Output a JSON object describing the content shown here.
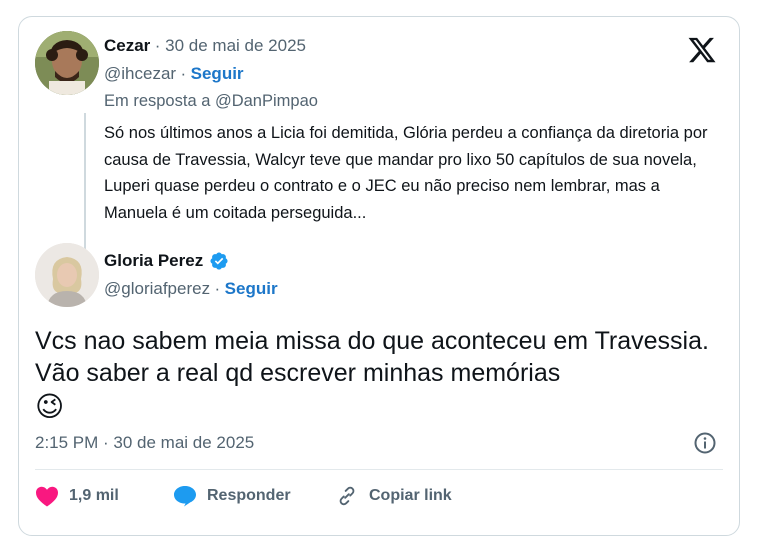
{
  "reply_tweet": {
    "author_name": "Cezar",
    "date_meta": "· 30 de mai de 2025",
    "handle": "@ihcezar",
    "sep": "·",
    "follow_label": "Seguir",
    "in_reply_to": "Em resposta a @DanPimpao",
    "text": "Só nos últimos anos a Licia foi demitida, Glória perdeu a confiança da diretoria por causa de Travessia, Walcyr teve que mandar pro lixo 50 capítulos de sua novela, Luperi quase perdeu o contrato e o JEC eu não preciso nem lembrar, mas a Manuela é um coitada perseguida..."
  },
  "main_tweet": {
    "author_name": "Gloria Perez",
    "verified_icon": "verified-badge-icon",
    "handle": "@gloriafperez",
    "sep": "·",
    "follow_label": "Seguir",
    "text": "Vcs nao sabem meia missa do que aconteceu em Travessia. Vão saber a real qd escrever minhas memórias",
    "emoji": "😉",
    "timestamp": "2:15 PM · 30 de mai de 2025"
  },
  "actions": {
    "likes": "1,9 mil",
    "reply_label": "Responder",
    "copy_link_label": "Copiar link"
  },
  "colors": {
    "accent": "#1d77c9",
    "verified": "#1d9bf0",
    "like": "#f91880",
    "muted": "#536471",
    "border": "#cfd9de"
  }
}
